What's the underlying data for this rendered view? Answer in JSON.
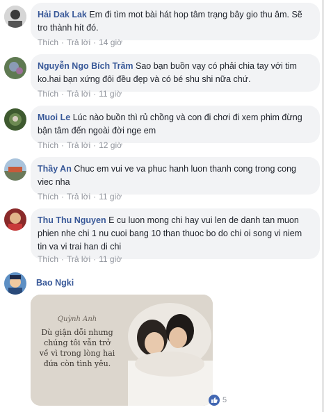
{
  "labels": {
    "like": "Thích",
    "reply": "Trả lời",
    "sep": "·"
  },
  "comments": [
    {
      "name": "Hải Dak Lak",
      "text": "Em đi tìm mot bài hát hop tâm trạng bây gio thu âm. Sẽ tro thành hít đó.",
      "time": "14 giờ"
    },
    {
      "name": "Nguyễn Ngo Bích Trâm",
      "text": "Sao bạn buồn vạy có phải chia tay với tim ko.hai bạn xứng đôi đều đẹp và có bé shu shi nữa chứ.",
      "time": "11 giờ"
    },
    {
      "name": "Muoi Le",
      "text": "Lúc nào buồn thì rủ chồng và con đi chơi đi xem phim đừng bận tâm đến ngoài đời nge em",
      "time": "12 giờ"
    },
    {
      "name": "Thầy An",
      "text": "Chuc em vui ve va phuc hanh luon thanh cong trong cong viec nha",
      "time": "11 giờ"
    },
    {
      "name": "Thu Thu Nguyen",
      "text": "E cu luon mong chi hay vui len de danh tan muon phien nhe chi 1 nu cuoi bang 10 than thuoc bo do chi oi song vi niem tin va vi trai han di chi",
      "time": "11 giờ"
    }
  ],
  "last": {
    "name": "Bao Ngki",
    "photo_signature": "Quỳnh Anh",
    "photo_text": "Dù giận dỗi nhưng chúng tôi vẫn trở về vì trong lòng hai đứa còn tình yêu.",
    "reactions": "5",
    "reaction_icon": "like-icon"
  },
  "colors": {
    "name": "#385898",
    "bubble": "#f2f3f5",
    "meta": "#90949c",
    "like": "#4267b2"
  }
}
